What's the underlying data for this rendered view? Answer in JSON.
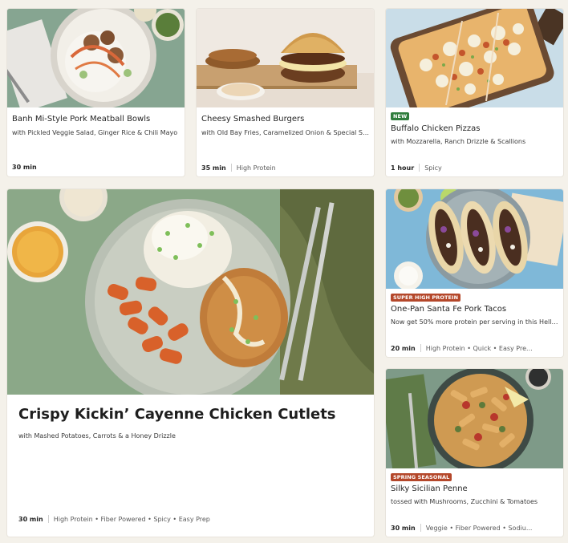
{
  "cards": [
    {
      "title": "Banh Mi-Style Pork Meatball Bowls",
      "subtitle": "with Pickled Veggie Salad, Ginger Rice & Chili Mayo",
      "time": "30 min",
      "tags": ""
    },
    {
      "title": "Cheesy Smashed Burgers",
      "subtitle": "with Old Bay Fries, Caramelized Onion & Special Sa...",
      "time": "35 min",
      "tags": "High Protein"
    },
    {
      "badge": "NEW",
      "badge_color": "#2f7d3d",
      "title": "Buffalo Chicken Pizzas",
      "subtitle": "with Mozzarella, Ranch Drizzle & Scallions",
      "time": "1 hour",
      "tags": "Spicy"
    },
    {
      "title": "Crispy Kickin’ Cayenne Chicken Cutlets",
      "subtitle": "with Mashed Potatoes, Carrots & a Honey Drizzle",
      "time": "30 min",
      "tags": "High Protein • Fiber Powered • Spicy • Easy Prep"
    },
    {
      "badge": "SUPER HIGH PROTEIN",
      "badge_color": "#b4472a",
      "title": "One-Pan Santa Fe Pork Tacos",
      "subtitle": "Now get 50% more protein per serving in this HelloF...",
      "time": "20 min",
      "tags": "High Protein • Quick • Easy Pre..."
    },
    {
      "badge": "SPRING SEASONAL",
      "badge_color": "#b4472a",
      "title": "Silky Sicilian Penne",
      "subtitle": "tossed with Mushrooms, Zucchini & Tomatoes",
      "time": "30 min",
      "tags": "Veggie • Fiber Powered • Sodiu..."
    }
  ],
  "icons": {
    "bowl": "meatball-bowl-photo",
    "burger": "burger-photo",
    "pizza": "pizza-photo",
    "chicken": "chicken-cutlet-photo",
    "tacos": "tacos-photo",
    "penne": "penne-photo"
  }
}
